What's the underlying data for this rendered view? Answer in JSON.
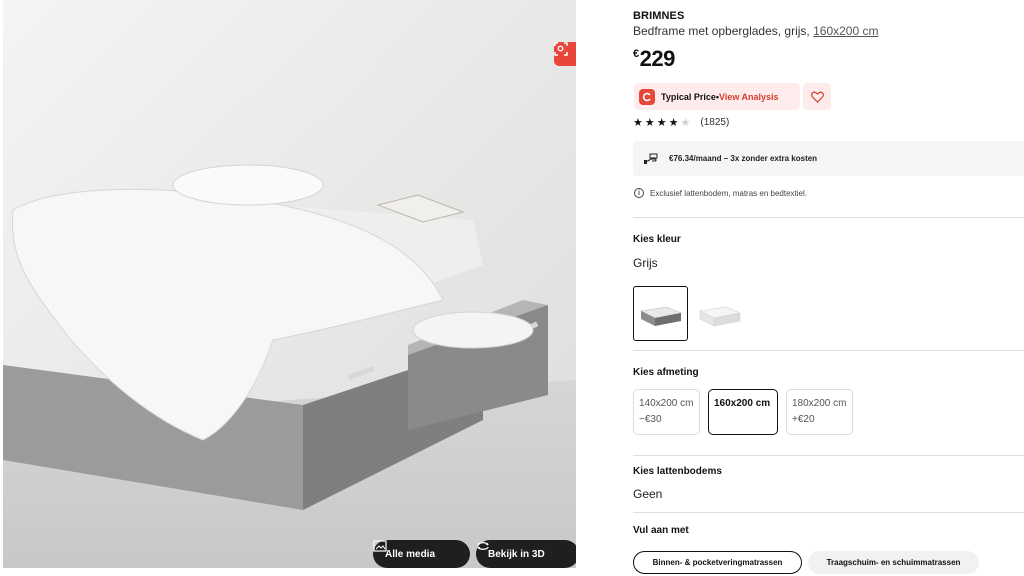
{
  "product": {
    "brand": "BRIMNES",
    "description": "Bedframe met opberglades, grijs,",
    "size_text": "160x200 cm",
    "currency": "€",
    "price": "229"
  },
  "media": {
    "all_media_label": "Alle media",
    "view_3d_label": "Bekijk in 3D"
  },
  "price_ext": {
    "typical_label": "Typical Price",
    "separator": " • ",
    "view_analysis_label": "View Analysis",
    "accent_color": "#e8463a"
  },
  "rating": {
    "stars": 4.5,
    "count": "(1825)"
  },
  "finance": {
    "text": "€76.34/maand – 3x zonder extra kosten"
  },
  "note": {
    "text": "Exclusief lattenbodem, matras en bedtextiel."
  },
  "color_section": {
    "label": "Kies kleur",
    "value": "Grijs"
  },
  "size_section": {
    "label": "Kies afmeting",
    "options": [
      {
        "size": "140x200 cm",
        "delta": "−€30"
      },
      {
        "size": "160x200 cm",
        "delta": ""
      },
      {
        "size": "180x200 cm",
        "delta": "+€20"
      }
    ]
  },
  "slats_section": {
    "label": "Kies lattenbodems",
    "value": "Geen"
  },
  "complete_section": {
    "label": "Vul aan met",
    "chips": [
      "Binnen- & pocketveringmatrassen",
      "Traagschuim- en schuimmatrassen"
    ]
  }
}
